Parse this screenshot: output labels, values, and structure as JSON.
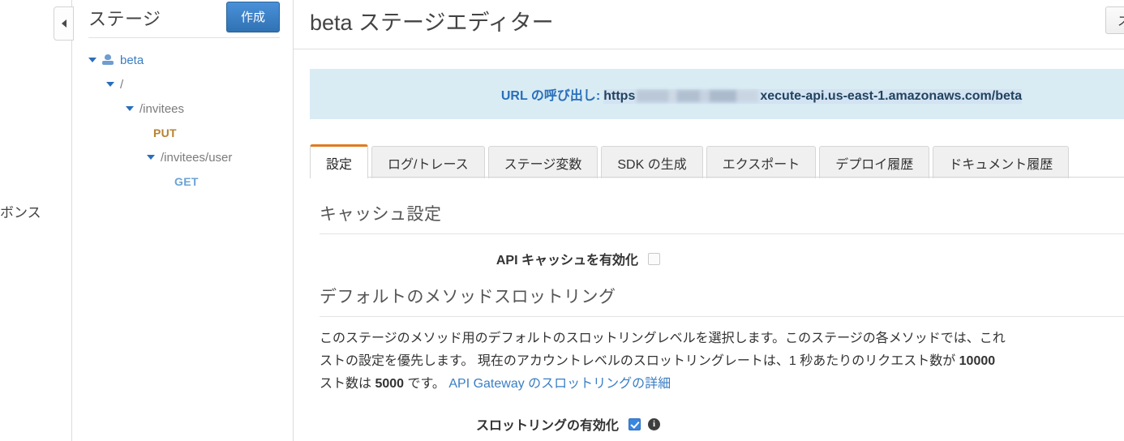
{
  "far_left": {
    "clipped_text": "ボンス"
  },
  "collapse_handle": {
    "icon": "triangle-left-icon"
  },
  "stages_panel": {
    "title": "ステージ",
    "create_button": "作成",
    "tree": [
      {
        "label": "beta",
        "type": "stage",
        "indent": 0,
        "expanded": true,
        "icon": "stage-icon"
      },
      {
        "label": "/",
        "type": "resource",
        "indent": 1,
        "expanded": true
      },
      {
        "label": "/invitees",
        "type": "resource",
        "indent": 2,
        "expanded": true
      },
      {
        "label": "PUT",
        "type": "method",
        "indent": 3,
        "expanded": false
      },
      {
        "label": "/invitees/user",
        "type": "resource",
        "indent": 3,
        "expanded": true
      },
      {
        "label": "GET",
        "type": "method",
        "indent": 4,
        "expanded": false
      }
    ]
  },
  "main": {
    "page_title": "beta ステージエディター",
    "delete_stage_button": "ステージの削除",
    "invoke_url": {
      "label": "URL の呼び出し:",
      "prefix": "https",
      "suffix": "xecute-api.us-east-1.amazonaws.com/beta",
      "redacted": true
    },
    "tabs": [
      {
        "label": "設定",
        "active": true
      },
      {
        "label": "ログ/トレース",
        "active": false
      },
      {
        "label": "ステージ変数",
        "active": false
      },
      {
        "label": "SDK の生成",
        "active": false
      },
      {
        "label": "エクスポート",
        "active": false
      },
      {
        "label": "デプロイ履歴",
        "active": false
      },
      {
        "label": "ドキュメント履歴",
        "active": false
      }
    ],
    "cache_section": {
      "title": "キャッシュ設定",
      "enable_api_cache_label": "API キャッシュを有効化",
      "enable_api_cache_checked": false
    },
    "throttling_section": {
      "title": "デフォルトのメソッドスロットリング",
      "description_line1": "このステージのメソッド用のデフォルトのスロットリングレベルを選択します。このステージの各メソッドでは、これ",
      "description_line2_a": "ストの設定を優先します。 現在のアカウントレベルのスロットリングレートは、1 秒あたりのリクエスト数が ",
      "description_line2_bold": "10000",
      "description_line3_a": "スト数は ",
      "description_line3_bold": "5000",
      "description_line3_b": " です。 ",
      "description_link": "API Gateway のスロットリングの詳細",
      "enable_throttling_label": "スロットリングの有効化",
      "enable_throttling_checked": true,
      "info_icon_glyph": "i"
    }
  },
  "colors": {
    "accent_blue": "#3a7ec4",
    "create_button_blue": "#3072b3",
    "active_tab_orange": "#e07b20",
    "banner_blue": "#d9ecf4",
    "method_put": "#b58330",
    "method_get": "#6ba3d6"
  }
}
